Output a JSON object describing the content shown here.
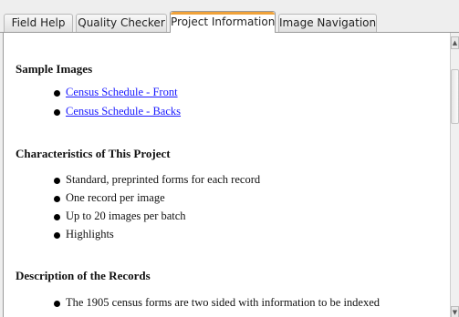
{
  "tabs": [
    {
      "label": "Field Help"
    },
    {
      "label": "Quality Checker"
    },
    {
      "label": "Project Information",
      "active": true
    },
    {
      "label": "Image Navigation"
    }
  ],
  "colors": {
    "active_tab_accent": "#f0a23a",
    "link": "#1a1aff",
    "panel_background": "#ffffff",
    "window_background": "#eeeeee"
  },
  "sections": [
    {
      "title": "Sample Images",
      "items": [
        {
          "text": "Census Schedule - Front",
          "link": true
        },
        {
          "text": "Census Schedule - Backs",
          "link": true
        }
      ]
    },
    {
      "title": "Characteristics of This Project",
      "items": [
        {
          "text": "Standard, preprinted forms for each record"
        },
        {
          "text": "One record per image"
        },
        {
          "text": "Up to 20 images per batch"
        },
        {
          "text": "Highlights"
        }
      ]
    },
    {
      "title": "Description of the Records",
      "items": [
        {
          "text": "The 1905 census forms are two sided with information to be indexed"
        }
      ]
    }
  ],
  "scrollbar": {
    "up_icon": "arrow-up-icon",
    "down_icon": "arrow-down-icon"
  }
}
